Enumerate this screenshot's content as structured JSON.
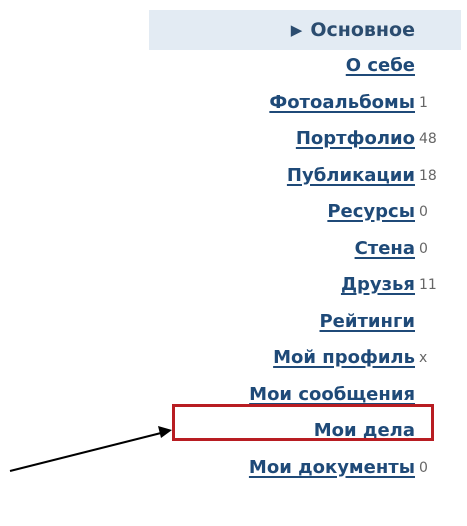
{
  "menu": {
    "header": "Основное",
    "items": [
      {
        "label": "О себе",
        "count": ""
      },
      {
        "label": "Фотоальбомы",
        "count": "1"
      },
      {
        "label": "Портфолио",
        "count": "48"
      },
      {
        "label": "Публикации",
        "count": "18"
      },
      {
        "label": "Ресурсы",
        "count": "0"
      },
      {
        "label": "Стена",
        "count": "0"
      },
      {
        "label": "Друзья",
        "count": "11"
      },
      {
        "label": "Рейтинги",
        "count": ""
      },
      {
        "label": "Мой профиль",
        "count": "x"
      },
      {
        "label": "Мои сообщения",
        "count": ""
      },
      {
        "label": "Мои дела",
        "count": ""
      },
      {
        "label": "Мои документы",
        "count": "0"
      }
    ]
  },
  "colors": {
    "header_bg": "#e3ebf3",
    "link": "#1f4a78",
    "highlight": "#b81d22"
  }
}
